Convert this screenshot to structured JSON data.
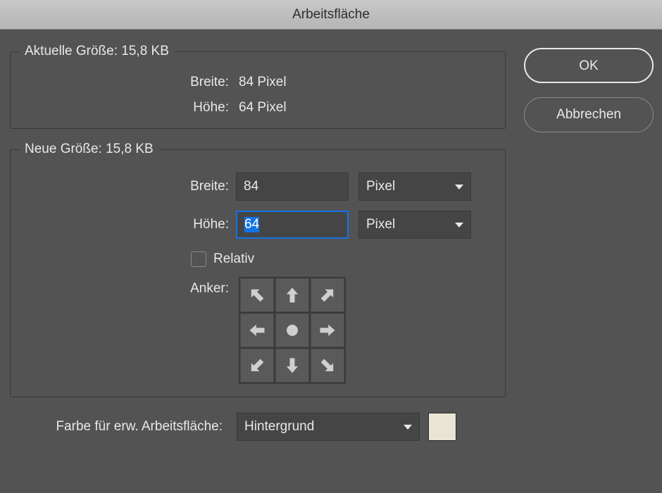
{
  "title": "Arbeitsfläche",
  "buttons": {
    "ok": "OK",
    "cancel": "Abbrechen"
  },
  "current_size": {
    "legend": "Aktuelle Größe: 15,8 KB",
    "width_label": "Breite:",
    "width_value": "84 Pixel",
    "height_label": "Höhe:",
    "height_value": "64 Pixel"
  },
  "new_size": {
    "legend": "Neue Größe: 15,8 KB",
    "width_label": "Breite:",
    "width_value": "84",
    "width_unit": "Pixel",
    "height_label": "Höhe:",
    "height_value": "64",
    "height_unit": "Pixel",
    "relative_label": "Relativ",
    "relative_checked": false,
    "anchor_label": "Anker:",
    "anchor_position": "center"
  },
  "extension": {
    "label": "Farbe für erw. Arbeitsfläche:",
    "value": "Hintergrund",
    "color": "#e9e4d6"
  }
}
